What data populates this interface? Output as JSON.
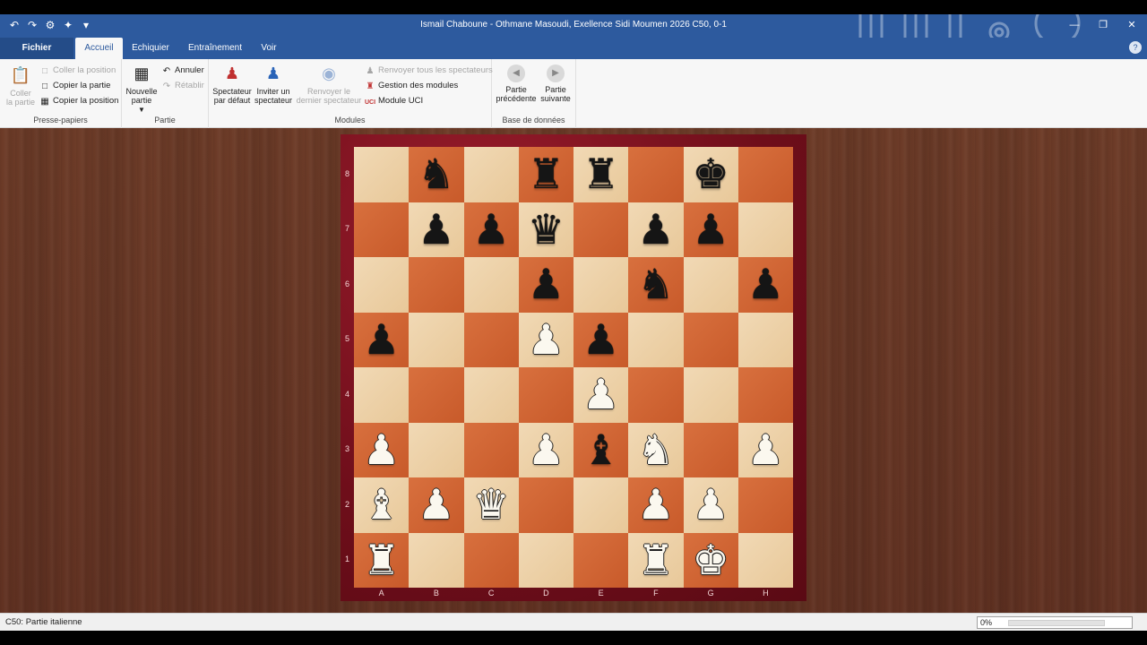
{
  "window": {
    "title": "Ismail Chaboune - Othmane Masoudi, Exellence Sidi Moumen 2026  C50, 0-1",
    "qat_icons": [
      "undo-icon",
      "redo-icon",
      "engine-icon",
      "pin-icon",
      "customize-icon"
    ],
    "controls": [
      "minimize",
      "restore",
      "close"
    ]
  },
  "tabs": {
    "file": "Fichier",
    "items": [
      {
        "label": "Accueil",
        "active": true
      },
      {
        "label": "Echiquier",
        "active": false
      },
      {
        "label": "Entraînement",
        "active": false
      },
      {
        "label": "Voir",
        "active": false
      }
    ]
  },
  "ribbon": {
    "clipboard": {
      "label": "Presse-papiers",
      "paste": "Coller\nla partie",
      "paste_position": "Coller la position",
      "copy_game": "Copier la partie",
      "copy_position": "Copier la position"
    },
    "game": {
      "label": "Partie",
      "new_game": "Nouvelle\npartie",
      "undo": "Annuler",
      "redo": "Rétablir"
    },
    "modules": {
      "label": "Modules",
      "default_spectator": "Spectateur\npar défaut",
      "invite_spectator": "Inviter un\nspectateur",
      "dismiss_last": "Renvoyer le\ndernier spectateur",
      "dismiss_all": "Renvoyer tous les spectateurs",
      "manage_modules": "Gestion des modules",
      "uci_module": "Module UCI"
    },
    "database": {
      "label": "Base de données",
      "previous_game": "Partie\nprécédente",
      "next_game": "Partie\nsuivante"
    }
  },
  "board": {
    "files": [
      "A",
      "B",
      "C",
      "D",
      "E",
      "F",
      "G",
      "H"
    ],
    "ranks": [
      "8",
      "7",
      "6",
      "5",
      "4",
      "3",
      "2",
      "1"
    ],
    "pieces": [
      {
        "square": "b8",
        "color": "b",
        "type": "knight"
      },
      {
        "square": "d8",
        "color": "b",
        "type": "rook"
      },
      {
        "square": "e8",
        "color": "b",
        "type": "rook"
      },
      {
        "square": "g8",
        "color": "b",
        "type": "king"
      },
      {
        "square": "b7",
        "color": "b",
        "type": "pawn"
      },
      {
        "square": "c7",
        "color": "b",
        "type": "pawn"
      },
      {
        "square": "d7",
        "color": "b",
        "type": "queen"
      },
      {
        "square": "f7",
        "color": "b",
        "type": "pawn"
      },
      {
        "square": "g7",
        "color": "b",
        "type": "pawn"
      },
      {
        "square": "d6",
        "color": "b",
        "type": "pawn"
      },
      {
        "square": "f6",
        "color": "b",
        "type": "knight"
      },
      {
        "square": "h6",
        "color": "b",
        "type": "pawn"
      },
      {
        "square": "a5",
        "color": "b",
        "type": "pawn"
      },
      {
        "square": "d5",
        "color": "w",
        "type": "pawn"
      },
      {
        "square": "e5",
        "color": "b",
        "type": "pawn"
      },
      {
        "square": "e4",
        "color": "w",
        "type": "pawn"
      },
      {
        "square": "a3",
        "color": "w",
        "type": "pawn"
      },
      {
        "square": "d3",
        "color": "w",
        "type": "pawn"
      },
      {
        "square": "e3",
        "color": "b",
        "type": "bishop"
      },
      {
        "square": "f3",
        "color": "w",
        "type": "knight"
      },
      {
        "square": "h3",
        "color": "w",
        "type": "pawn"
      },
      {
        "square": "a2",
        "color": "w",
        "type": "bishop"
      },
      {
        "square": "b2",
        "color": "w",
        "type": "pawn"
      },
      {
        "square": "c2",
        "color": "w",
        "type": "queen"
      },
      {
        "square": "f2",
        "color": "w",
        "type": "pawn"
      },
      {
        "square": "g2",
        "color": "w",
        "type": "pawn"
      },
      {
        "square": "a1",
        "color": "w",
        "type": "rook"
      },
      {
        "square": "f1",
        "color": "w",
        "type": "rook"
      },
      {
        "square": "g1",
        "color": "w",
        "type": "king"
      }
    ]
  },
  "status": {
    "opening": "C50: Partie italienne",
    "progress_text": "0%",
    "progress_fraction": 0.0
  },
  "colors": {
    "accent": "#2d5a9e",
    "light_square": "#f1d9b5",
    "dark_square": "#d8703e",
    "board_frame": "#8a1524"
  }
}
